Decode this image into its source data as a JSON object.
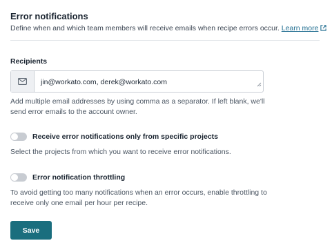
{
  "section": {
    "title": "Error notifications",
    "description": "Define when and which team members will receive emails when recipe errors occur.",
    "learn_more": "Learn more"
  },
  "recipients": {
    "label": "Recipients",
    "icon": "email-icon",
    "value": "jin@workato.com, derek@workato.com",
    "hint": "Add multiple email addresses by using comma as a separator. If left blank, we'll send error emails to the account owner."
  },
  "specific_projects": {
    "label": "Receive error notifications only from specific projects",
    "enabled": false,
    "description": "Select the projects from which you want to receive error notifications."
  },
  "throttling": {
    "label": "Error notification throttling",
    "enabled": false,
    "description": "To avoid getting too many notifications when an error occurs, enable throttling to receive only one email per hour per recipe."
  },
  "actions": {
    "save_label": "Save"
  },
  "colors": {
    "primary": "#1a6e7e",
    "link": "#1e6c8f",
    "toggle_off": "#c8ccd2"
  }
}
